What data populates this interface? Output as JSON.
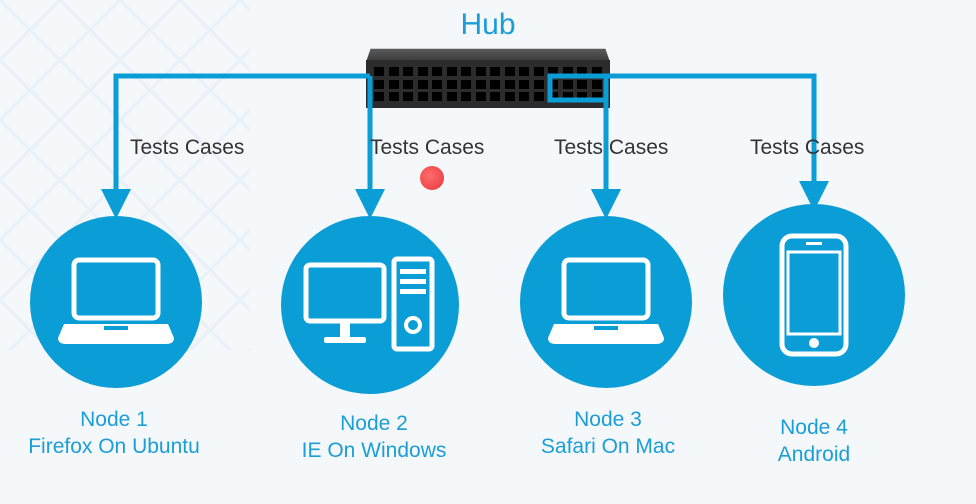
{
  "hub": {
    "label": "Hub"
  },
  "arrow_labels": {
    "a1": "Tests Cases",
    "a2": "Tests Cases",
    "a3": "Tests Cases",
    "a4": "Tests Cases"
  },
  "nodes": {
    "n1": {
      "title": "Node 1",
      "subtitle": "Firefox On Ubuntu"
    },
    "n2": {
      "title": "Node 2",
      "subtitle": "IE On Windows"
    },
    "n3": {
      "title": "Node 3",
      "subtitle": "Safari On Mac"
    },
    "n4": {
      "title": "Node 4",
      "subtitle": "Android"
    }
  },
  "colors": {
    "accent": "#0b9dd6",
    "text_blue": "#1b9ed6",
    "hub_body": "#2c2c2c",
    "dot": "#e8383c"
  }
}
